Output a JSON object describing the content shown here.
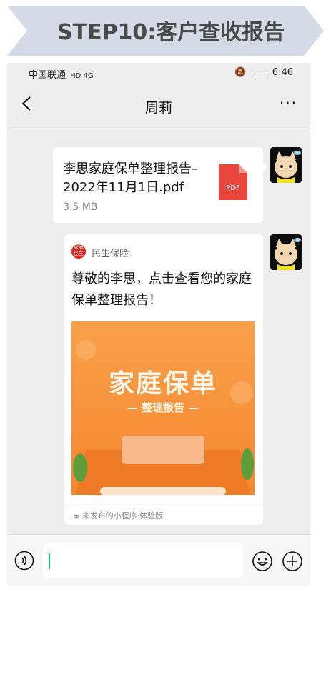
{
  "banner": {
    "title": "STEP10:客户查收报告"
  },
  "status_bar": {
    "carrier": "中国联通",
    "network": "HD 4G",
    "time": "6:46"
  },
  "chat": {
    "contact_name": "周莉",
    "more_label": "···"
  },
  "file_message": {
    "file_name": "李思家庭保单整理报告–2022年11月1日.pdf",
    "file_size": "3.5 MB",
    "file_type": "PDF"
  },
  "mini_program_card": {
    "source_name": "民生保险",
    "source_logo_text": "家庭民生",
    "message": "尊敬的李思，点击查看您的家庭保单整理报告！",
    "cover_title": "家庭保单",
    "cover_subtitle": "— 整理报告 —",
    "footer": "未发布的小程序·体验版"
  },
  "colors": {
    "brand_red": "#d9261c",
    "cover_orange": "#f6862f",
    "caret_green": "#07c160"
  }
}
